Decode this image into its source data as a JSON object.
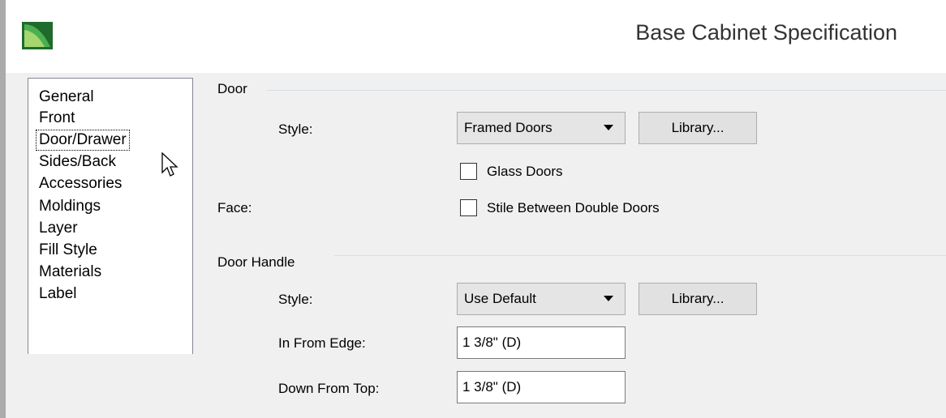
{
  "window": {
    "title": "Base Cabinet Specification",
    "app_icon": "app-logo-icon"
  },
  "nav": {
    "items": [
      {
        "label": "General"
      },
      {
        "label": "Front"
      },
      {
        "label": "Door/Drawer",
        "selected": true
      },
      {
        "label": "Sides/Back"
      },
      {
        "label": "Accessories"
      },
      {
        "label": "Moldings"
      },
      {
        "label": "Layer"
      },
      {
        "label": "Fill Style"
      },
      {
        "label": "Materials"
      },
      {
        "label": "Label"
      }
    ]
  },
  "door": {
    "section_label": "Door",
    "style_label": "Style:",
    "style_value": "Framed Doors",
    "library_label": "Library...",
    "glass_doors_label": "Glass Doors",
    "glass_doors_checked": false,
    "face_label": "Face:",
    "stile_label": "Stile Between Double Doors",
    "stile_checked": false
  },
  "door_handle": {
    "section_label": "Door Handle",
    "style_label": "Style:",
    "style_value": "Use Default",
    "library_label": "Library...",
    "in_from_edge_label": "In From Edge:",
    "in_from_edge_value": "1 3/8\" (D)",
    "down_from_top_label": "Down From Top:",
    "down_from_top_value": "1 3/8\" (D)"
  },
  "colors": {
    "dialog_bg": "#f0f0f0",
    "list_border": "#828790",
    "groupbox_line": "#d5dfe5",
    "icon_green": "#2e8b3a"
  }
}
